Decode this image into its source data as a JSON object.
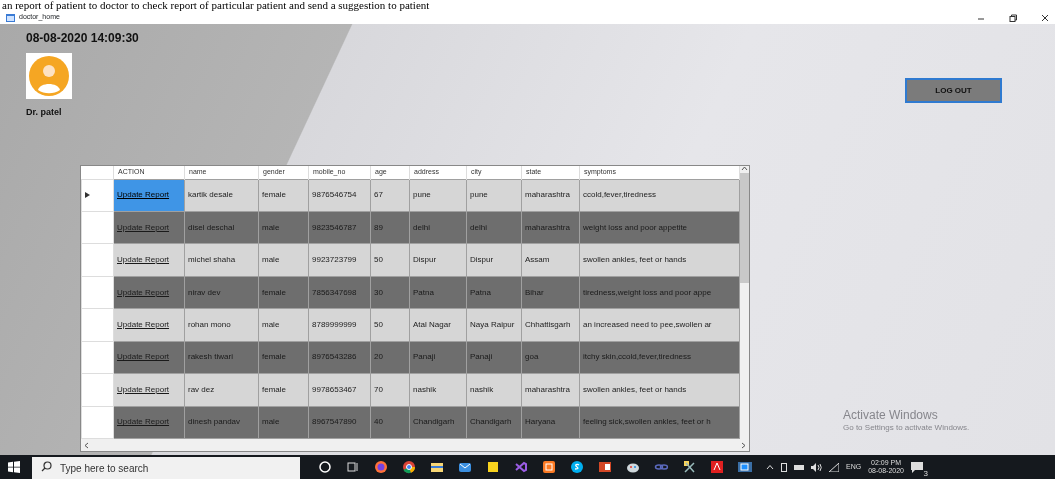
{
  "caption": "an report of patient to doctor to check report of particular patient and send a suggestion to patient",
  "window": {
    "title": "doctor_home"
  },
  "header": {
    "datetime": "08-08-2020 14:09:30",
    "doctor_name": "Dr. patel",
    "logout_button": "LOG OUT"
  },
  "table": {
    "columns": [
      "ACTION",
      "name",
      "gender",
      "mobile_no",
      "age",
      "address",
      "city",
      "state",
      "symptoms"
    ],
    "rows": [
      {
        "selected": true,
        "cells": [
          "Update Report",
          "kartik desale",
          "female",
          "9876546754",
          "67",
          "pune",
          "pune",
          "maharashtra",
          "ccold,fever,tiredness"
        ]
      },
      {
        "selected": false,
        "cells": [
          "Update Report",
          "disel deschal",
          "male",
          "9823546787",
          "89",
          "delhi",
          "delhi",
          "maharashtra",
          "weight loss and poor appetite"
        ]
      },
      {
        "selected": false,
        "cells": [
          "Update Report",
          "michel shaha",
          "male",
          "9923723799",
          "50",
          "Dispur",
          "Dispur",
          "Assam",
          "swollen ankles, feet or hands"
        ]
      },
      {
        "selected": false,
        "cells": [
          "Update Report",
          "nirav dev",
          "female",
          "7856347698",
          "30",
          "Patna",
          "Patna",
          "Bihar",
          "tiredness,weight loss and poor appe"
        ]
      },
      {
        "selected": false,
        "cells": [
          "Update Report",
          "rohan mono",
          "male",
          "8789999999",
          "50",
          "Atal Nagar",
          "Naya Raipur",
          "Chhattisgarh",
          "an increased need to pee,swollen ar"
        ]
      },
      {
        "selected": false,
        "cells": [
          "Update Report",
          "rakesh tiwari",
          "female",
          "8976543286",
          "20",
          "Panaji",
          "Panaji",
          "goa",
          "itchy skin,ccold,fever,tiredness"
        ]
      },
      {
        "selected": false,
        "cells": [
          "Update Report",
          "rav dez",
          "female",
          "9978653467",
          "70",
          "nashik",
          "nashik",
          "maharashtra",
          "swollen ankles, feet or hands"
        ]
      },
      {
        "selected": false,
        "cells": [
          "Update Report",
          "dinesh pandav",
          "male",
          "8967547890",
          "40",
          "Chandigarh",
          "Chandigarh",
          "Haryana",
          "feeling sick,swollen ankles, feet or h"
        ]
      }
    ]
  },
  "watermark": {
    "title": "Activate Windows",
    "subtitle": "Go to Settings to activate Windows."
  },
  "taskbar": {
    "search": {
      "placeholder": "Type here to search"
    },
    "language": "ENG",
    "time": "02:09 PM",
    "date": "08-08-2020",
    "notification_count": "3"
  }
}
